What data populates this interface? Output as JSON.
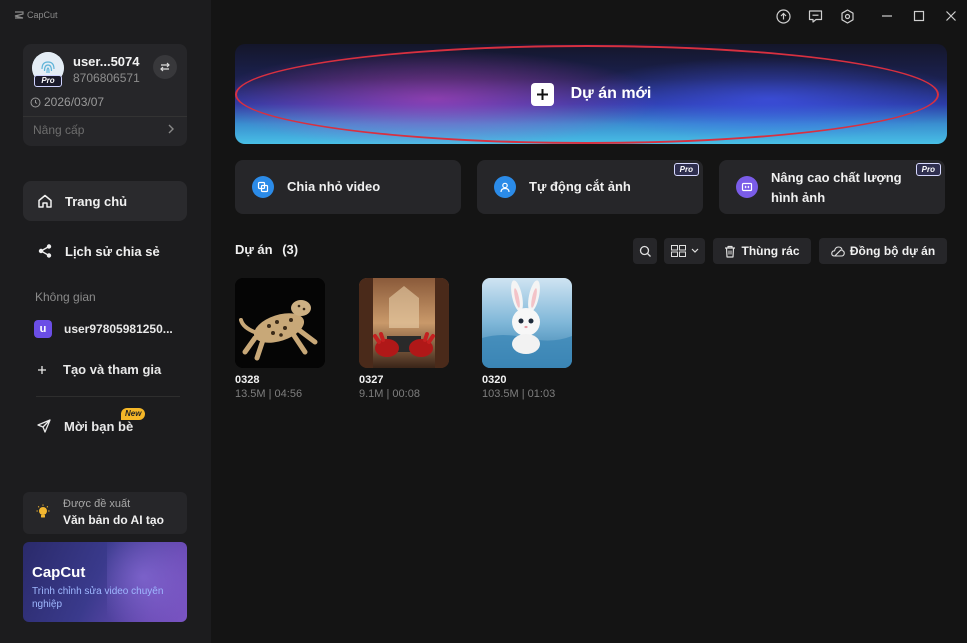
{
  "app": {
    "name": "CapCut"
  },
  "colors": {
    "background": "#141414",
    "sidebar": "#1c1c1e",
    "card": "#262629",
    "accent_purple": "#6b4ee6",
    "highlight_outline": "#d83040",
    "new_badge": "#f5b728"
  },
  "user": {
    "name": "user...5074",
    "id": "8706806571",
    "plan_badge": "Pro",
    "expiry": "2026/03/07",
    "upgrade_label": "Nâng cấp"
  },
  "nav": [
    {
      "label": "Trang chủ",
      "icon": "home-icon",
      "active": true
    },
    {
      "label": "Lịch sử chia sẻ",
      "icon": "share-icon",
      "active": false
    }
  ],
  "space": {
    "section_label": "Không gian",
    "user_space": {
      "avatar_letter": "u",
      "label": "user97805981250..."
    },
    "create_join_label": "Tạo và tham gia"
  },
  "invite": {
    "label": "Mời bạn bè",
    "badge": "New"
  },
  "suggest": {
    "small_text": "Được đề xuất",
    "title": "Văn bản do AI tạo"
  },
  "promo": {
    "title": "CapCut",
    "subtitle": "Trình chỉnh sửa video chuyên nghiệp"
  },
  "hero": {
    "label": "Dự án mới"
  },
  "features": [
    {
      "label": "Chia nhỏ video",
      "icon": "split-video-icon",
      "pro": false,
      "color": "#2b8be8"
    },
    {
      "label": "Tự động cắt ảnh",
      "icon": "auto-cutout-icon",
      "pro": true,
      "pro_label": "Pro",
      "color": "#2b8be8"
    },
    {
      "label": "Nâng cao chất lượng hình ảnh",
      "icon": "enhance-quality-icon",
      "pro": true,
      "pro_label": "Pro",
      "color": "#7a5ce8"
    }
  ],
  "projects": {
    "title": "Dự án",
    "count": "(3)",
    "trash_label": "Thùng rác",
    "sync_label": "Đồng bộ dự án",
    "items": [
      {
        "name": "0328",
        "meta": "13.5M | 04:56",
        "thumb": "leopard"
      },
      {
        "name": "0327",
        "meta": "9.1M | 00:08",
        "thumb": "red-gloves"
      },
      {
        "name": "0320",
        "meta": "103.5M | 01:03",
        "thumb": "white-rabbit"
      }
    ]
  }
}
